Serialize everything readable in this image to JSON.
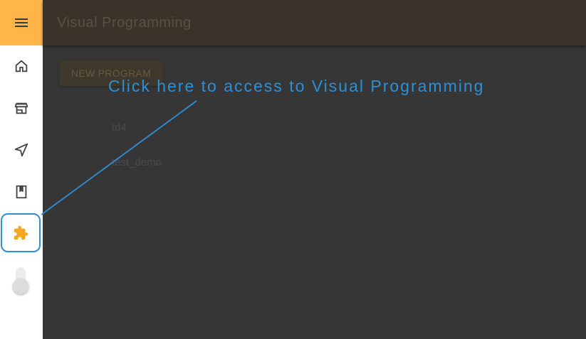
{
  "app": {
    "title": "Visual Programming"
  },
  "sidebar": {
    "items": [
      {
        "name": "home",
        "icon": "home-icon"
      },
      {
        "name": "store",
        "icon": "store-icon"
      },
      {
        "name": "navigation",
        "icon": "send-icon"
      },
      {
        "name": "book",
        "icon": "book-icon"
      },
      {
        "name": "visual-programming",
        "icon": "puzzle-icon",
        "active": true
      }
    ],
    "accent_color": "#ffb547",
    "active_icon_color": "#f5a623"
  },
  "toolbar": {
    "new_program_label": "NEW PROGRAM"
  },
  "programs": [
    "td4",
    "test_demo"
  ],
  "callout": {
    "text": "Click here to access to Visual Programming",
    "color": "#2d8fd6"
  }
}
